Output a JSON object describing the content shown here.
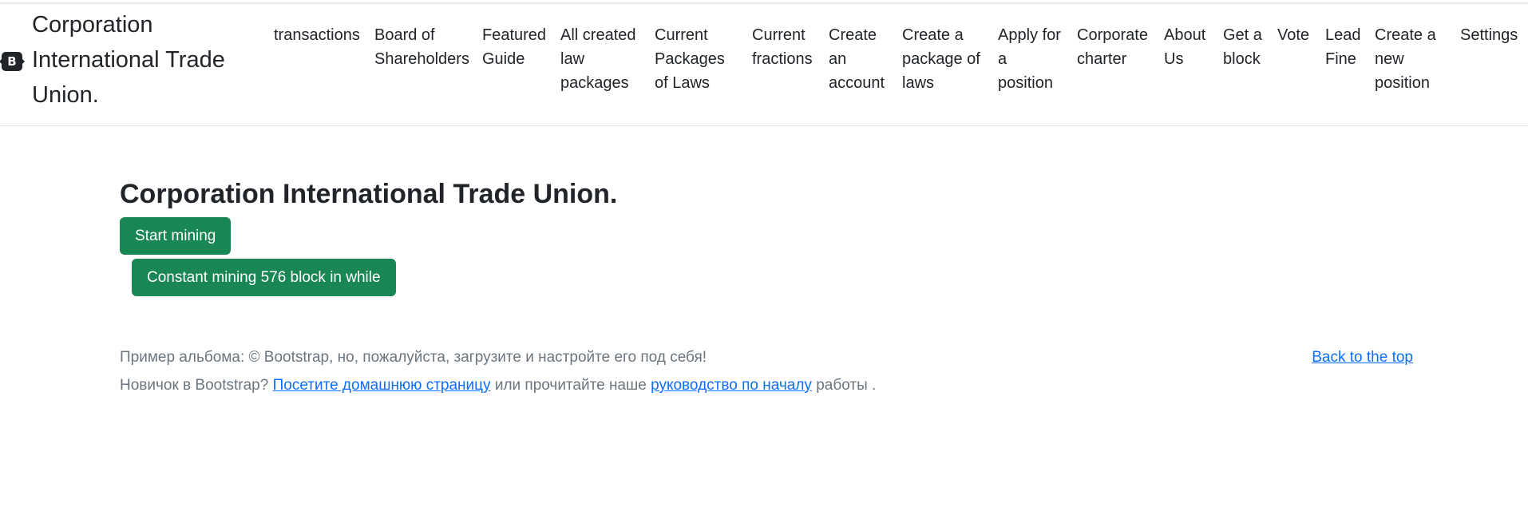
{
  "header": {
    "brand_icon_text": "B",
    "brand_title": "Corporation International Trade Union.",
    "nav_items": [
      {
        "label": "transactions"
      },
      {
        "label": "Board of Shareholders"
      },
      {
        "label": "Featured Guide"
      },
      {
        "label": "All created law packages"
      },
      {
        "label": "Current Packages of Laws"
      },
      {
        "label": "Current fractions"
      },
      {
        "label": "Create an account"
      },
      {
        "label": "Create a package of laws"
      },
      {
        "label": "Apply for a position"
      },
      {
        "label": "Corporate charter"
      },
      {
        "label": "About Us"
      },
      {
        "label": "Get a block"
      },
      {
        "label": "Vote"
      },
      {
        "label": "Lead Fine"
      },
      {
        "label": "Create a new position"
      },
      {
        "label": "Settings"
      }
    ]
  },
  "main": {
    "title": "Corporation International Trade Union.",
    "start_mining_label": "Start mining",
    "constant_mining_label": "Constant mining 576 block in while"
  },
  "footer": {
    "back_to_top": "Back to the top",
    "line1": "Пример альбома: © Bootstrap, но, пожалуйста, загрузите и настройте его под себя!",
    "line2_prefix": "Новичок в Bootstrap?",
    "line2_link1": "Посетите домашнюю страницу",
    "line2_middle": "или прочитайте наше",
    "line2_link2": "руководство по началу",
    "line2_suffix": "работы ."
  },
  "colors": {
    "accent_button": "#198754",
    "link": "#0d6efd",
    "muted_text": "#6c757d"
  }
}
